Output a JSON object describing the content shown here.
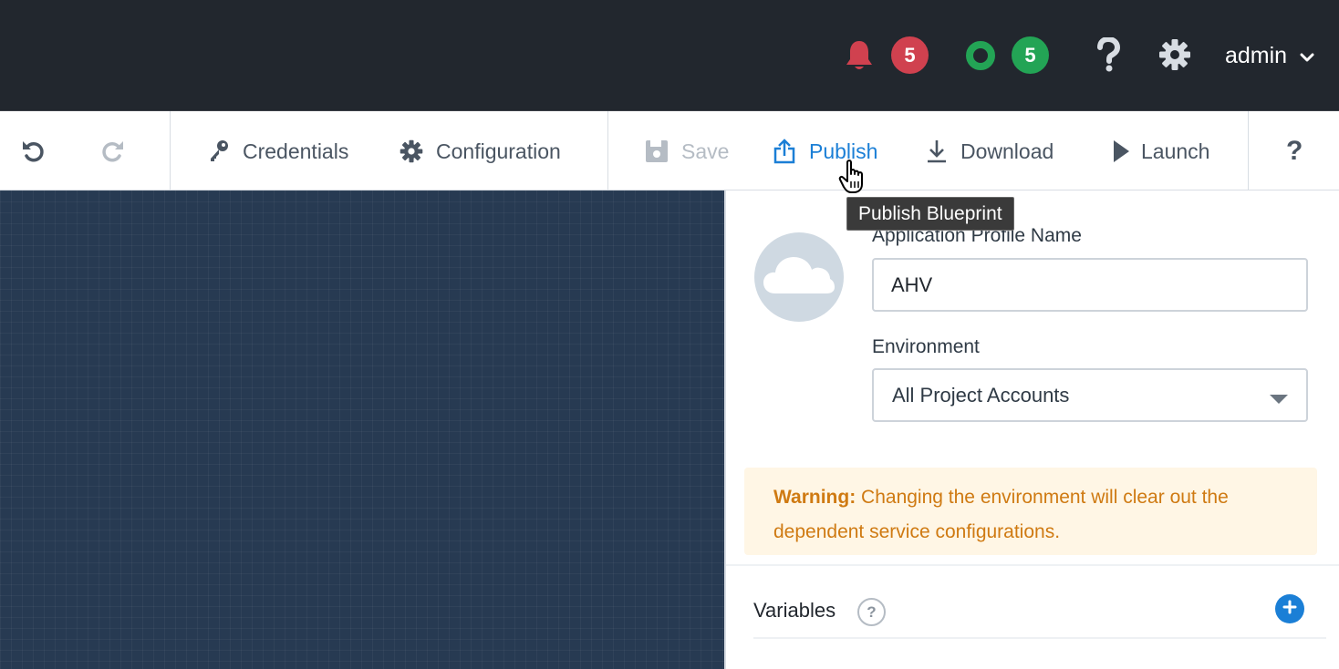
{
  "topbar": {
    "alerts_count": "5",
    "tasks_count": "5",
    "help_icon": "question-icon",
    "settings_icon": "gear-icon",
    "username": "admin"
  },
  "toolbar": {
    "undo_icon": "undo-icon",
    "redo_icon": "redo-icon",
    "credentials_label": "Credentials",
    "configuration_label": "Configuration",
    "save_label": "Save",
    "publish_label": "Publish",
    "download_label": "Download",
    "launch_label": "Launch",
    "help_label": "?"
  },
  "tooltip": {
    "text": "Publish Blueprint"
  },
  "panel": {
    "profile_name_label": "Application Profile Name",
    "profile_name_value": "AHV",
    "environment_label": "Environment",
    "environment_value": "All Project Accounts",
    "warning_prefix": "Warning:",
    "warning_text": " Changing the environment will clear out the dependent service configurations.",
    "variables_label": "Variables",
    "variables_help": "?"
  },
  "colors": {
    "topbar_bg": "#22272e",
    "canvas_bg": "#273a52",
    "alert_badge": "#d0414f",
    "task_badge": "#23a455",
    "accent": "#1b7fd6",
    "warning_text": "#cf7a12",
    "warning_bg": "#fff6e5"
  }
}
